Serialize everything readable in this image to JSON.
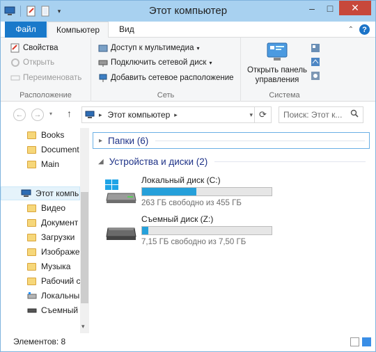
{
  "window": {
    "title": "Этот компьютер"
  },
  "tabs": {
    "file": "Файл",
    "computer": "Компьютер",
    "view": "Вид"
  },
  "ribbon": {
    "location": {
      "label": "Расположение",
      "items": [
        "Свойства",
        "Открыть",
        "Переименовать"
      ]
    },
    "network": {
      "label": "Сеть",
      "items": [
        "Доступ к мультимедиа",
        "Подключить сетевой диск",
        "Добавить сетевое расположение"
      ]
    },
    "system": {
      "label": "Система",
      "control_panel_line1": "Открыть панель",
      "control_panel_line2": "управления"
    }
  },
  "address": {
    "crumb": "Этот компьютер"
  },
  "search": {
    "placeholder": "Поиск: Этот к..."
  },
  "nav_pane": {
    "favorites": [
      "Books",
      "Document",
      "Main"
    ],
    "this_pc": "Этот компь",
    "children": [
      "Видео",
      "Документ",
      "Загрузки",
      "Изображе",
      "Музыка",
      "Рабочий с",
      "Локальны",
      "Съемный"
    ]
  },
  "content": {
    "folders_header": "Папки (6)",
    "devices_header": "Устройства и диски (2)",
    "drives": [
      {
        "name": "Локальный диск (C:)",
        "free": "263 ГБ свободно из 455 ГБ",
        "used_fraction": 0.42
      },
      {
        "name": "Съемный диск (Z:)",
        "free": "7,15 ГБ свободно из 7,50 ГБ",
        "used_fraction": 0.05
      }
    ]
  },
  "status": {
    "items_count": "Элементов: 8"
  },
  "colors": {
    "accent": "#1979ca",
    "progress": "#26a0da",
    "titlebar": "#a8d1f0"
  }
}
